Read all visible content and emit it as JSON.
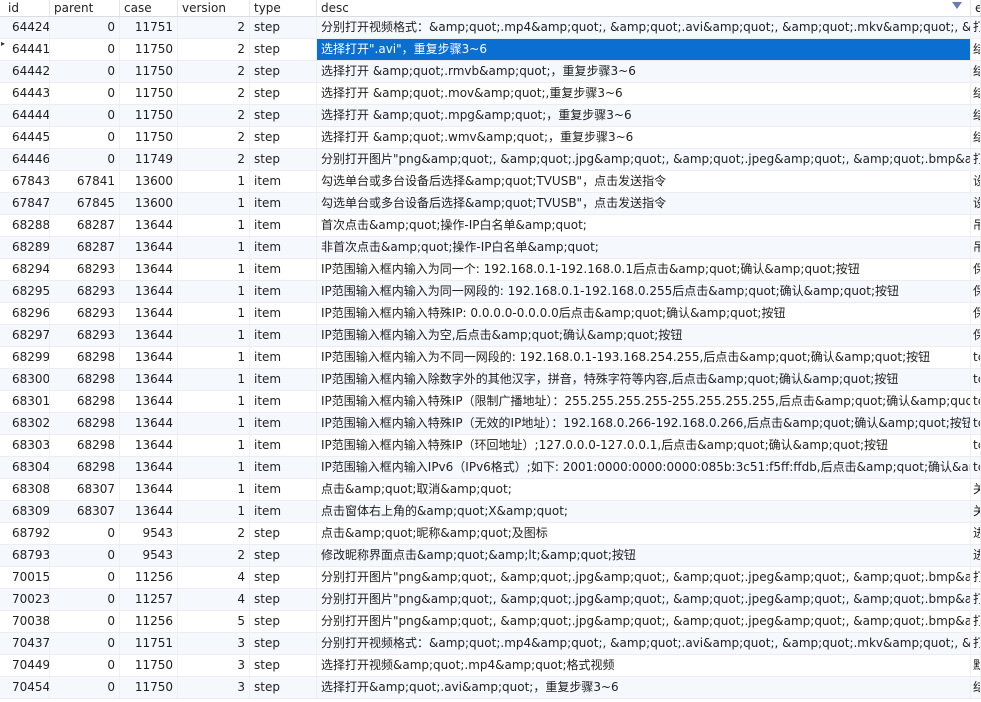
{
  "columns": {
    "id": "id",
    "parent": "parent",
    "case": "case",
    "version": "version",
    "type": "type",
    "desc": "desc",
    "ext": "ex"
  },
  "rows": [
    {
      "id": "64424",
      "parent": "0",
      "case": "11751",
      "version": "2",
      "type": "step",
      "desc": "分别打开视频格式：&amp;quot;.mp4&amp;quot;, &amp;quot;.avi&amp;quot;, &amp;quot;.mkv&amp;quot;, &amp;quot",
      "ext": "打"
    },
    {
      "id": "64441",
      "parent": "0",
      "case": "11750",
      "version": "2",
      "type": "step",
      "desc": "选择打开\".avi\"，重复步骤3~6",
      "ext": "结"
    },
    {
      "id": "64442",
      "parent": "0",
      "case": "11750",
      "version": "2",
      "type": "step",
      "desc": "选择打开 &amp;quot;.rmvb&amp;quot;，重复步骤3~6",
      "ext": "结"
    },
    {
      "id": "64443",
      "parent": "0",
      "case": "11750",
      "version": "2",
      "type": "step",
      "desc": "选择打开  &amp;quot;.mov&amp;quot;,重复步骤3~6",
      "ext": "结"
    },
    {
      "id": "64444",
      "parent": "0",
      "case": "11750",
      "version": "2",
      "type": "step",
      "desc": "选择打开 &amp;quot;.mpg&amp;quot;，重复步骤3~6",
      "ext": "结"
    },
    {
      "id": "64445",
      "parent": "0",
      "case": "11750",
      "version": "2",
      "type": "step",
      "desc": " 选择打开 &amp;quot;.wmv&amp;quot;，重复步骤3~6",
      "ext": "结"
    },
    {
      "id": "64446",
      "parent": "0",
      "case": "11749",
      "version": "2",
      "type": "step",
      "desc": "分别打开图片\"png&amp;quot;, &amp;quot;.jpg&amp;quot;, &amp;quot;.jpeg&amp;quot;, &amp;quot;.bmp&amp;",
      "ext": "打"
    },
    {
      "id": "67843",
      "parent": "67841",
      "case": "13600",
      "version": "1",
      "type": "item",
      "desc": "勾选单台或多台设备后选择&amp;quot;TVUSB\"，点击发送指令",
      "ext": "设"
    },
    {
      "id": "67847",
      "parent": "67845",
      "case": "13600",
      "version": "1",
      "type": "item",
      "desc": "勾选单台或多台设备后选择&amp;quot;TVUSB\"，点击发送指令",
      "ext": "设"
    },
    {
      "id": "68288",
      "parent": "68287",
      "case": "13644",
      "version": "1",
      "type": "item",
      "desc": "首次点击&amp;quot;操作-IP白名单&amp;quot;",
      "ext": "吊"
    },
    {
      "id": "68289",
      "parent": "68287",
      "case": "13644",
      "version": "1",
      "type": "item",
      "desc": "非首次点击&amp;quot;操作-IP白名单&amp;quot;",
      "ext": "吊"
    },
    {
      "id": "68294",
      "parent": "68293",
      "case": "13644",
      "version": "1",
      "type": "item",
      "desc": "IP范围输入框内输入为同一个: 192.168.0.1-192.168.0.1后点击&amp;quot;确认&amp;quot;按钮",
      "ext": "保"
    },
    {
      "id": "68295",
      "parent": "68293",
      "case": "13644",
      "version": "1",
      "type": "item",
      "desc": "IP范围输入框内输入为同一网段的: 192.168.0.1-192.168.0.255后点击&amp;quot;确认&amp;quot;按钮",
      "ext": "保"
    },
    {
      "id": "68296",
      "parent": "68293",
      "case": "13644",
      "version": "1",
      "type": "item",
      "desc": "IP范围输入框内输入特殊IP: 0.0.0.0-0.0.0.0后点击&amp;quot;确认&amp;quot;按钮",
      "ext": "保"
    },
    {
      "id": "68297",
      "parent": "68293",
      "case": "13644",
      "version": "1",
      "type": "item",
      "desc": "IP范围输入框内输入为空,后点击&amp;quot;确认&amp;quot;按钮",
      "ext": "保"
    },
    {
      "id": "68299",
      "parent": "68298",
      "case": "13644",
      "version": "1",
      "type": "item",
      "desc": "IP范围输入框内输入为不同一网段的: 192.168.0.1-193.168.254.255,后点击&amp;quot;确认&amp;quot;按钮",
      "ext": "tc"
    },
    {
      "id": "68300",
      "parent": "68298",
      "case": "13644",
      "version": "1",
      "type": "item",
      "desc": "IP范围输入框内输入除数字外的其他汉字，拼音，特殊字符等内容,后点击&amp;quot;确认&amp;quot;按钮",
      "ext": "tc"
    },
    {
      "id": "68301",
      "parent": "68298",
      "case": "13644",
      "version": "1",
      "type": "item",
      "desc": "IP范围输入框内输入特殊IP（限制广播地址）：255.255.255.255-255.255.255.255,后点击&amp;quot;确认&amp;quot;按",
      "ext": "tc"
    },
    {
      "id": "68302",
      "parent": "68298",
      "case": "13644",
      "version": "1",
      "type": "item",
      "desc": "IP范围输入框内输入特殊IP（无效的IP地址）：192.168.0.266-192.168.0.266,后点击&amp;quot;确认&amp;quot;按钮",
      "ext": "tc"
    },
    {
      "id": "68303",
      "parent": "68298",
      "case": "13644",
      "version": "1",
      "type": "item",
      "desc": "IP范围输入框内输入特殊IP（环回地址）;127.0.0.0-127.0.0.1,后点击&amp;quot;确认&amp;quot;按钮",
      "ext": "tc"
    },
    {
      "id": "68304",
      "parent": "68298",
      "case": "13644",
      "version": "1",
      "type": "item",
      "desc": "IP范围输入框内输入IPv6（IPv6格式）;如下: 2001:0000:0000:0000:085b:3c51:f5ff:ffdb,后点击&amp;quot;确认&amp;qu",
      "ext": "tc"
    },
    {
      "id": "68308",
      "parent": "68307",
      "case": "13644",
      "version": "1",
      "type": "item",
      "desc": "点击&amp;quot;取消&amp;quot;",
      "ext": "关"
    },
    {
      "id": "68309",
      "parent": "68307",
      "case": "13644",
      "version": "1",
      "type": "item",
      "desc": "点击窗体右上角的&amp;quot;X&amp;quot;",
      "ext": "关"
    },
    {
      "id": "68792",
      "parent": "0",
      "case": "9543",
      "version": "2",
      "type": "step",
      "desc": "点击&amp;quot;昵称&amp;quot;及图标",
      "ext": "进"
    },
    {
      "id": "68793",
      "parent": "0",
      "case": "9543",
      "version": "2",
      "type": "step",
      "desc": "修改昵称界面点击&amp;quot;&amp;lt;&amp;quot;按钮",
      "ext": "进"
    },
    {
      "id": "70015",
      "parent": "0",
      "case": "11256",
      "version": "4",
      "type": "step",
      "desc": "分别打开图片\"png&amp;quot;, &amp;quot;.jpg&amp;quot;, &amp;quot;.jpeg&amp;quot;, &amp;quot;.bmp&amp;",
      "ext": "打"
    },
    {
      "id": "70023",
      "parent": "0",
      "case": "11257",
      "version": "4",
      "type": "step",
      "desc": "分别打开图片\"png&amp;quot;, &amp;quot;.jpg&amp;quot;, &amp;quot;.jpeg&amp;quot;, &amp;quot;.bmp&amp;",
      "ext": "打"
    },
    {
      "id": "70038",
      "parent": "0",
      "case": "11256",
      "version": "5",
      "type": "step",
      "desc": "分别打开图片\"png&amp;quot;, &amp;quot;.jpg&amp;quot;, &amp;quot;.jpeg&amp;quot;, &amp;quot;.bmp&amp;",
      "ext": "打"
    },
    {
      "id": "70437",
      "parent": "0",
      "case": "11751",
      "version": "3",
      "type": "step",
      "desc": "分别打开视频格式：&amp;quot;.mp4&amp;quot;, &amp;quot;.avi&amp;quot;, &amp;quot;.mkv&amp;quot;, &amp;quot",
      "ext": "打"
    },
    {
      "id": "70449",
      "parent": "0",
      "case": "11750",
      "version": "3",
      "type": "step",
      "desc": "选择打开视频&amp;quot;.mp4&amp;quot;格式视频",
      "ext": "默"
    },
    {
      "id": "70454",
      "parent": "0",
      "case": "11750",
      "version": "3",
      "type": "step",
      "desc": "选择打开&amp;quot;.avi&amp;quot;，重复步骤3~6",
      "ext": "结"
    }
  ],
  "selected_row_index": 1,
  "icons": {
    "filter": "filter-icon",
    "current_row": "row-pointer-icon"
  },
  "colors": {
    "selection": "#0a6fd1",
    "alt_row": "#f5f8fd",
    "filter": "#6a7cb3"
  }
}
